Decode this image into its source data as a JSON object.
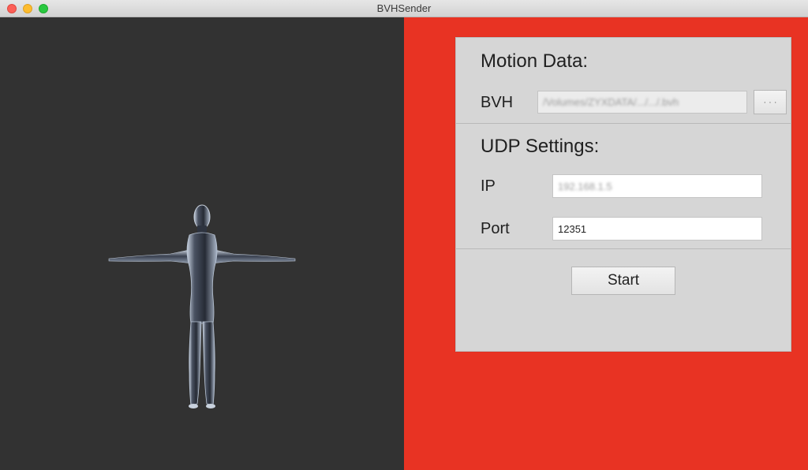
{
  "window": {
    "title": "BVHSender"
  },
  "motion_data": {
    "heading": "Motion Data:",
    "bvh_label": "BVH",
    "bvh_path": "/Volumes/ZYXDATA/.../.../.bvh",
    "browse_label": "· · ·"
  },
  "udp_settings": {
    "heading": "UDP Settings:",
    "ip_label": "IP",
    "ip_value": "192.168.1.5",
    "port_label": "Port",
    "port_value": "12351"
  },
  "actions": {
    "start_label": "Start"
  },
  "colors": {
    "viewport_bg": "#323232",
    "right_bg": "#e83323",
    "panel_bg": "#d6d6d6"
  }
}
